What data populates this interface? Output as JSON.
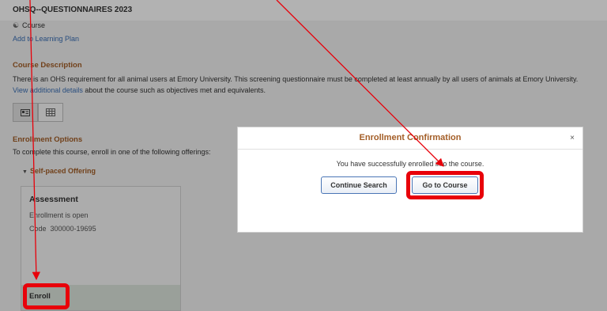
{
  "course": {
    "title": "OHSQ--QUESTIONNAIRES 2023",
    "type_icon": "course-icon",
    "type_label": "Course",
    "add_to_plan": "Add to Learning Plan"
  },
  "description": {
    "heading": "Course Description",
    "text": "There is an OHS requirement for all animal users at Emory University. This screening questionnaire must be completed at least annually by all users of animals at Emory University.",
    "link": "View additional details",
    "link_suffix": " about the course such as objectives met and equivalents."
  },
  "view_toggle": {
    "card_view_icon": "card-view-icon",
    "grid_view_icon": "grid-view-icon"
  },
  "enrollment": {
    "heading": "Enrollment Options",
    "subtitle": "To complete this course, enroll in one of the following offerings:",
    "offering_label": "Self-paced Offering",
    "card": {
      "title": "Assessment",
      "status": "Enrollment is open",
      "code_label": "Code",
      "code_value": "300000-19695",
      "enroll_label": "Enroll"
    }
  },
  "modal": {
    "title": "Enrollment Confirmation",
    "close": "×",
    "message": "You have successfully enrolled into the course.",
    "continue_label": "Continue Search",
    "go_label": "Go to Course"
  },
  "colors": {
    "accent": "#a35d26",
    "link": "#3a6fb5",
    "annotation_red": "#e8000a"
  }
}
